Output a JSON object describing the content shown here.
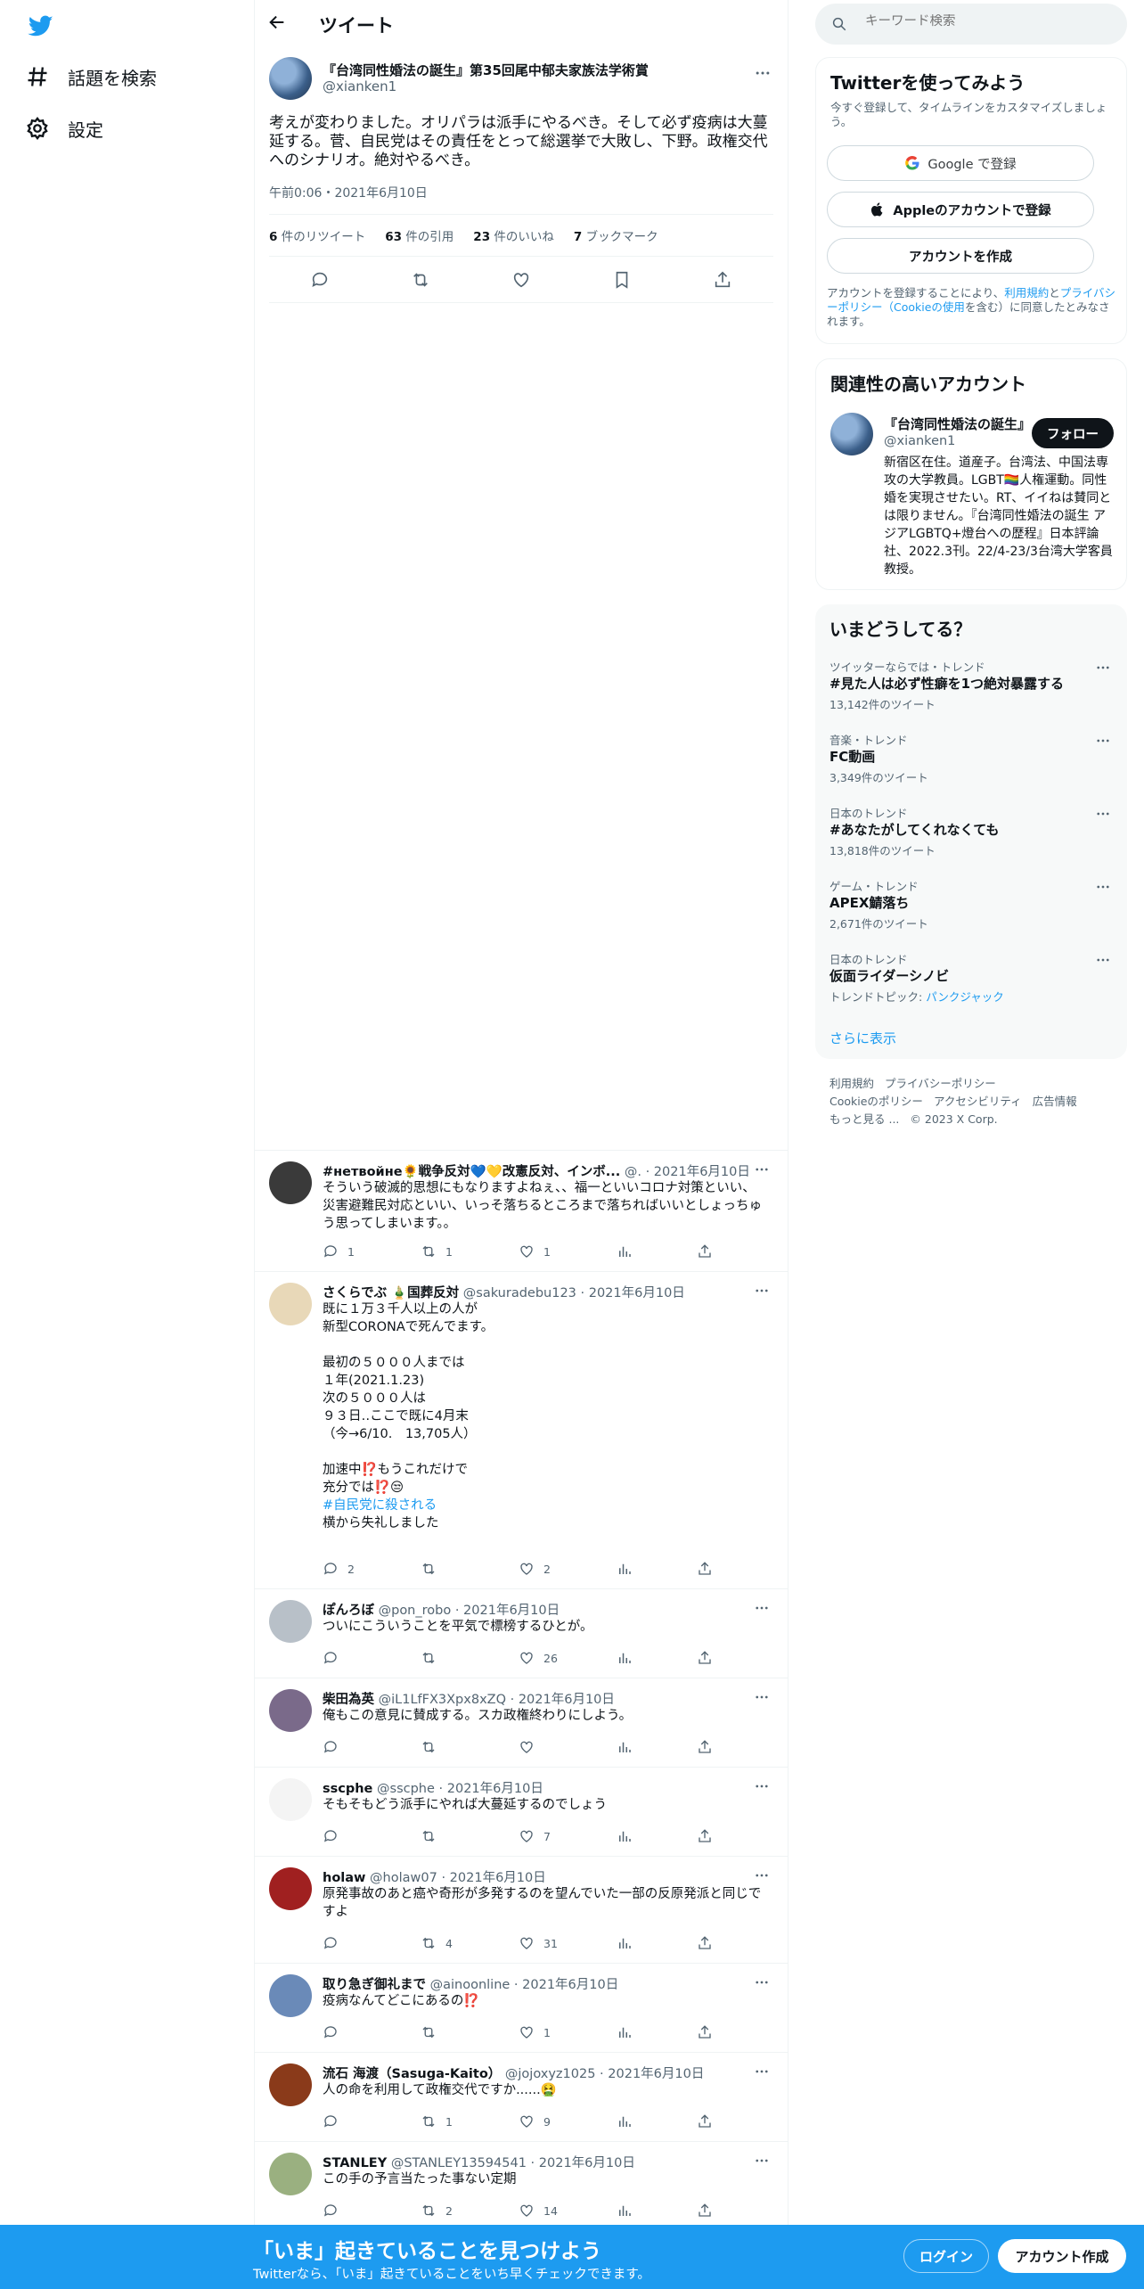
{
  "colors": {
    "accent": "#1d9bf0",
    "text": "#0f1419",
    "secondary": "#536471",
    "bottom_bar": "#1d9bf0"
  },
  "nav": {
    "logo": "twitter-bird-icon",
    "items": [
      {
        "icon": "hashtag-icon",
        "label": "話題を検索"
      },
      {
        "icon": "gear-icon",
        "label": "設定"
      }
    ]
  },
  "header": {
    "title": "ツイート"
  },
  "main_tweet": {
    "name": "『台湾同性婚法の誕生』第35回尾中郁夫家族法学術賞",
    "handle": "@xianken1",
    "text": "考えが変わりました。オリパラは派手にやるべき。そして必ず疫病は大蔓延する。菅、自民党はその責任をとって総選挙で大敗し、下野。政権交代へのシナリオ。絶対やるべき。",
    "time": "午前0:06・2021年6月10日",
    "stats": {
      "retweets_count": "6",
      "retweets_label": "件のリツイート",
      "quotes_count": "63",
      "quotes_label": "件の引用",
      "likes_count": "23",
      "likes_label": "件のいいね",
      "bookmarks_count": "7",
      "bookmarks_label": "ブックマーク"
    }
  },
  "replies": [
    {
      "name": "#нетвойне🌻戦争反対💙💛改憲反対、インボ...",
      "handle": "@.",
      "date": "2021年6月10日",
      "text": "そういう破滅的思想にもなりますよねぇ、、福一といいコロナ対策といい、災害避難民対応といい、いっそ落ちるところまで落ちればいいとしょっちゅう思ってしまいます。。",
      "replies": "1",
      "retweets": "1",
      "likes": "1"
    },
    {
      "name": "さくらでぶ 🎍国葬反対",
      "handle": "@sakuradebu123",
      "date": "2021年6月10日",
      "text": "既に１万３千人以上の人が\n新型CORONAで死んでます。\n\n最初の５０００人までは\n１年(2021.1.23)\n次の５０００人は\n９３日‥ここで既に4月末\n（今→6/10.　13,705人）\n\n加速中⁉️もうこれだけで\n充分では⁉️😒",
      "hashtag": "#自民党に殺される",
      "text2": "横から失礼しました",
      "replies": "2",
      "retweets": "",
      "likes": "2"
    },
    {
      "name": "ぽんろぼ",
      "handle": "@pon_robo",
      "date": "2021年6月10日",
      "text": "ついにこういうことを平気で標榜するひとが。",
      "replies": "",
      "retweets": "",
      "likes": "26"
    },
    {
      "name": "柴田為英",
      "handle": "@iL1LfFX3Xpx8xZQ",
      "date": "2021年6月10日",
      "text": "俺もこの意見に賛成する。スカ政権終わりにしよう。",
      "replies": "",
      "retweets": "",
      "likes": ""
    },
    {
      "name": "sscphe",
      "handle": "@sscphe",
      "date": "2021年6月10日",
      "text": "そもそもどう派手にやれば大蔓延するのでしょう",
      "replies": "",
      "retweets": "",
      "likes": "7"
    },
    {
      "name": "holaw",
      "handle": "@holaw07",
      "date": "2021年6月10日",
      "text": "原発事故のあと癌や奇形が多発するのを望んでいた一部の反原発派と同じですよ",
      "replies": "",
      "retweets": "4",
      "likes": "31"
    },
    {
      "name": "取り急ぎ御礼まで",
      "handle": "@ainoonline",
      "date": "2021年6月10日",
      "text": "疫病なんてどこにあるの⁉️",
      "replies": "",
      "retweets": "",
      "likes": "1"
    },
    {
      "name": "流石 海渡（Sasuga-Kaito）",
      "handle": "@jojoxyz1025",
      "date": "2021年6月10日",
      "text": "人の命を利用して政権交代ですか......🤮",
      "replies": "",
      "retweets": "1",
      "likes": "9"
    },
    {
      "name": "STANLEY",
      "handle": "@STANLEY13594541",
      "date": "2021年6月10日",
      "text": "この手の予言当たった事ない定期",
      "replies": "",
      "retweets": "2",
      "likes": "14"
    }
  ],
  "search": {
    "placeholder": "キーワード検索"
  },
  "signup": {
    "title": "Twitterを使ってみよう",
    "subtitle": "今すぐ登録して、タイムラインをカスタマイズしましょう。",
    "google": "Google で登録",
    "apple": "Appleのアカウントで登録",
    "create": "アカウントを作成",
    "terms_pre": "アカウントを登録することにより、",
    "terms_link1": "利用規約",
    "terms_mid": "と",
    "terms_link2": "プライバシーポリシー（Cookieの使用",
    "terms_post": "を含む）に同意したとみなされます。"
  },
  "related": {
    "title": "関連性の高いアカウント",
    "name": "『台湾同性婚法の誕生』第35回尾中郁夫家族法学術賞",
    "handle": "@xianken1",
    "follow": "フォロー",
    "bio": "新宿区在住。道産子。台湾法、中国法専攻の大学教員。LGBT🏳️‍🌈人権運動。同性婚を実現させたい。RT、イイねは賛同とは限りません。『台湾同性婚法の誕生 アジアLGBTQ+燈台への歴程』日本評論社、2022.3刊。22/4-23/3台湾大学客員教授。"
  },
  "trends": {
    "title": "いまどうしてる？",
    "items": [
      {
        "context": "ツイッターならでは・トレンド",
        "name": "#見た人は必ず性癖を1つ絶対暴露する",
        "count": "13,142件のツイート"
      },
      {
        "context": "音楽・トレンド",
        "name": "FC動画",
        "count": "3,349件のツイート"
      },
      {
        "context": "日本のトレンド",
        "name": "#あなたがしてくれなくても",
        "count": "13,818件のツイート"
      },
      {
        "context": "ゲーム・トレンド",
        "name": "APEX鯖落ち",
        "count": "2,671件のツイート"
      },
      {
        "context": "日本のトレンド",
        "name": "仮面ライダーシノビ",
        "count_prefix": "トレンドトピック: ",
        "count_link": "パンクジャック"
      }
    ],
    "show_more": "さらに表示"
  },
  "footer": {
    "links": [
      "利用規約",
      "プライバシーポリシー",
      "Cookieのポリシー",
      "アクセシビリティ",
      "広告情報",
      "もっと見る ..."
    ],
    "copyright": "© 2023 X Corp."
  },
  "bottom_bar": {
    "title": "「いま」起きていることを見つけよう",
    "subtitle": "Twitterなら、「いま」起きていることをいち早くチェックできます。",
    "login": "ログイン",
    "signup": "アカウント作成"
  }
}
